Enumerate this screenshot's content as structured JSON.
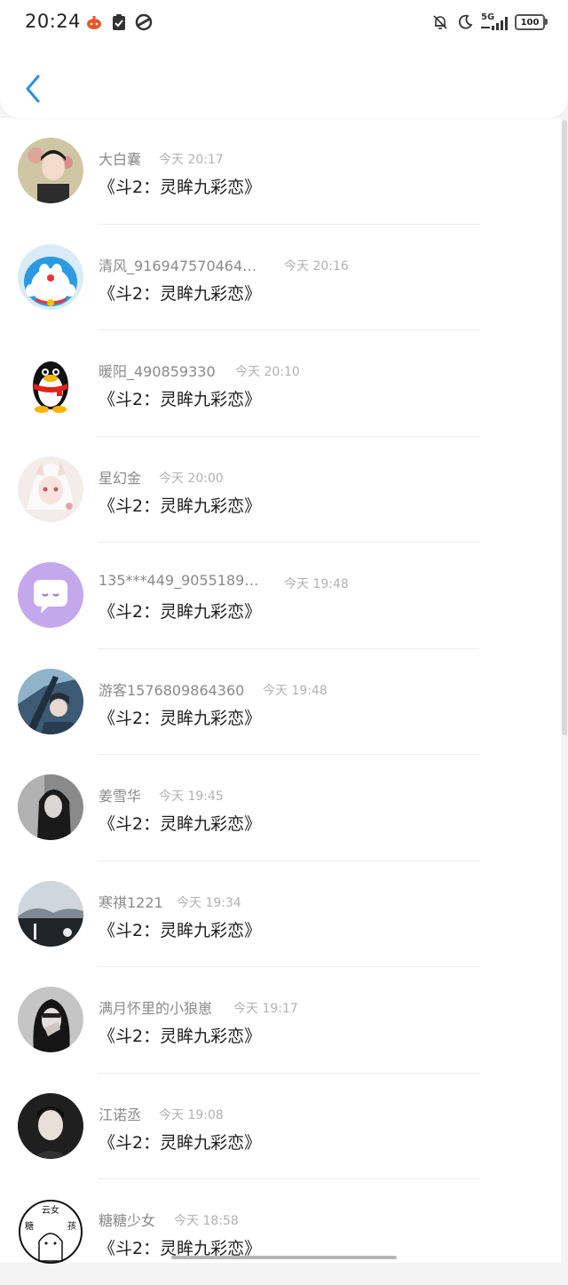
{
  "status_bar": {
    "time": "20:24",
    "network": "5G",
    "battery": "100"
  },
  "header": {
    "back_icon": "chevron-left-icon",
    "accent_color": "#2b8fe0"
  },
  "comments": [
    {
      "name": "大白囊",
      "time": "今天 20:17",
      "text": "《斗2：灵眸九彩恋》",
      "avatar": "boy-portrait"
    },
    {
      "name": "清风_916947570464…",
      "time": "今天 20:16",
      "text": "《斗2：灵眸九彩恋》",
      "avatar": "doraemon"
    },
    {
      "name": "暖阳_490859330",
      "time": "今天 20:10",
      "text": "《斗2：灵眸九彩恋》",
      "avatar": "qq-penguin"
    },
    {
      "name": "星幻金",
      "time": "今天 20:00",
      "text": "《斗2：灵眸九彩恋》",
      "avatar": "anime-girl"
    },
    {
      "name": "135***449_9055189…",
      "time": "今天 19:48",
      "text": "《斗2：灵眸九彩恋》",
      "avatar": "purple-chat"
    },
    {
      "name": "游客1576809864360",
      "time": "今天 19:48",
      "text": "《斗2：灵眸九彩恋》",
      "avatar": "anime-warrior"
    },
    {
      "name": "姜雪华",
      "time": "今天 19:45",
      "text": "《斗2：灵眸九彩恋》",
      "avatar": "dark-girl"
    },
    {
      "name": "寒祺1221",
      "time": "今天 19:34",
      "text": "《斗2：灵眸九彩恋》",
      "avatar": "landscape"
    },
    {
      "name": "满月怀里的小狼崽",
      "time": "今天 19:17",
      "text": "《斗2：灵眸九彩恋》",
      "avatar": "girl-hand"
    },
    {
      "name": "江诺丞",
      "time": "今天 19:08",
      "text": "《斗2：灵眸九彩恋》",
      "avatar": "boy-dark"
    },
    {
      "name": "糖糖少女",
      "time": "今天 18:58",
      "text": "《斗2：灵眸九彩恋》",
      "avatar": "sketch-girl",
      "avatar_text": "糖云女孩"
    }
  ]
}
